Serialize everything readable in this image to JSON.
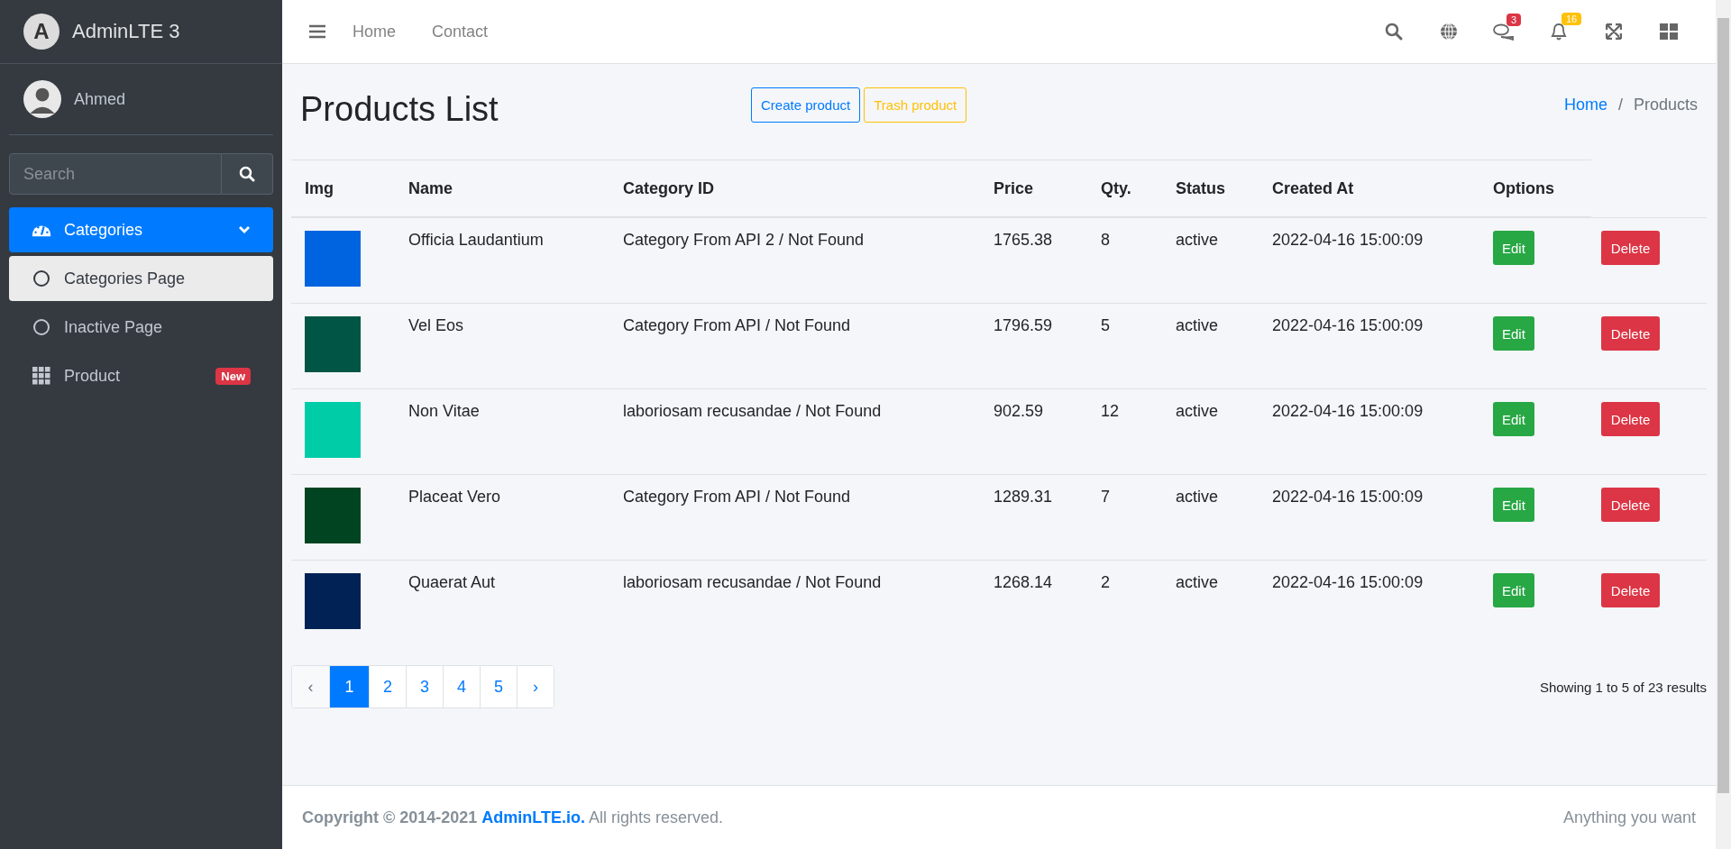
{
  "brand": {
    "logo_letter": "A",
    "name": "AdminLTE 3"
  },
  "user": {
    "name": "Ahmed"
  },
  "sidebar": {
    "search": {
      "placeholder": "Search"
    },
    "items": [
      {
        "label": "Categories",
        "kind": "group",
        "selected": true,
        "expanded": true,
        "children": [
          {
            "label": "Categories Page",
            "selected": true
          },
          {
            "label": "Inactive Page",
            "selected": false
          }
        ]
      },
      {
        "label": "Product",
        "kind": "item",
        "selected": false,
        "badge": "New"
      }
    ]
  },
  "navbar": {
    "links": [
      "Home",
      "Contact"
    ],
    "icons": [
      {
        "kind": "search"
      },
      {
        "kind": "globe"
      },
      {
        "kind": "comments",
        "badge": "3",
        "color": "#dc3545"
      },
      {
        "kind": "bell",
        "badge": "16",
        "color": "#ffc107"
      },
      {
        "kind": "expand"
      },
      {
        "kind": "grid"
      }
    ]
  },
  "page": {
    "title": "Products List",
    "actions": [
      {
        "label": "Create product",
        "kind": "primary"
      },
      {
        "label": "Trash product",
        "kind": "warning"
      }
    ],
    "breadcrumb": [
      {
        "label": "Home",
        "selected": false
      },
      {
        "label": "Products",
        "selected": true
      }
    ],
    "breadcrumb_separator": "/"
  },
  "table": {
    "columns": [
      "Img",
      "Name",
      "Category ID",
      "Price",
      "Qty.",
      "Status",
      "Created At",
      "Options"
    ],
    "rows": [
      {
        "color": "#0064e0",
        "name": "Officia Laudantium",
        "category": "Category From API 2 / Not Found",
        "price": "1765.38",
        "qty": "8",
        "status": "active",
        "created": "2022-04-16 15:00:09",
        "edit": "Edit",
        "delete": "Delete"
      },
      {
        "color": "#005544",
        "name": "Vel Eos",
        "category": "Category From API / Not Found",
        "price": "1796.59",
        "qty": "5",
        "status": "active",
        "created": "2022-04-16 15:00:09",
        "edit": "Edit",
        "delete": "Delete"
      },
      {
        "color": "#00cca8",
        "name": "Non Vitae",
        "category": "laboriosam recusandae / Not Found",
        "price": "902.59",
        "qty": "12",
        "status": "active",
        "created": "2022-04-16 15:00:09",
        "edit": "Edit",
        "delete": "Delete"
      },
      {
        "color": "#004422",
        "name": "Placeat Vero",
        "category": "Category From API / Not Found",
        "price": "1289.31",
        "qty": "7",
        "status": "active",
        "created": "2022-04-16 15:00:09",
        "edit": "Edit",
        "delete": "Delete"
      },
      {
        "color": "#002255",
        "name": "Quaerat Aut",
        "category": "laboriosam recusandae / Not Found",
        "price": "1268.14",
        "qty": "2",
        "status": "active",
        "created": "2022-04-16 15:00:09",
        "edit": "Edit",
        "delete": "Delete"
      }
    ]
  },
  "pagination": {
    "prev": "‹",
    "next": "›",
    "pages": [
      {
        "label": "1",
        "selected": true
      },
      {
        "label": "2",
        "selected": false
      },
      {
        "label": "3",
        "selected": false
      },
      {
        "label": "4",
        "selected": false
      },
      {
        "label": "5",
        "selected": false
      }
    ],
    "summary": "Showing 1 to 5 of 23 results"
  },
  "footer": {
    "copyright": "**Copyright © 2014-2021**",
    "link": "AdminLTE.io.",
    "rest": "All rights reserved.",
    "right": "Anything you want"
  }
}
